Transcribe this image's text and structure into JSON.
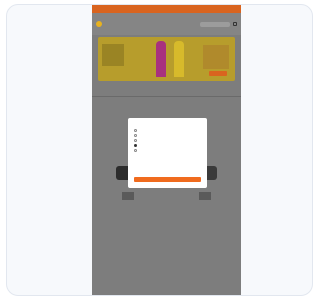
{
  "promo_bar": {
    "text": ""
  },
  "header": {
    "brand": "",
    "nav": [
      "",
      "",
      ""
    ]
  },
  "hero": {
    "cta": ""
  },
  "info": [
    {
      "label_1": "",
      "label_2": ""
    },
    {
      "label_1": "",
      "label_2": ""
    }
  ],
  "tabs": [
    "",
    "",
    "",
    "",
    "",
    ""
  ],
  "section_label": "",
  "products": [
    {
      "name": "",
      "price": ""
    },
    {
      "name": "",
      "price": ""
    }
  ],
  "see_all": "",
  "brand_heading": "",
  "modal": {
    "title": "",
    "link": "",
    "subtitle": "",
    "options": [
      "",
      "",
      "",
      "",
      ""
    ],
    "selected_index": 3,
    "button": ""
  },
  "colors": {
    "accent": "#f06b1e",
    "overlay": "#7d7d7d",
    "hero": "#b79d2c"
  }
}
